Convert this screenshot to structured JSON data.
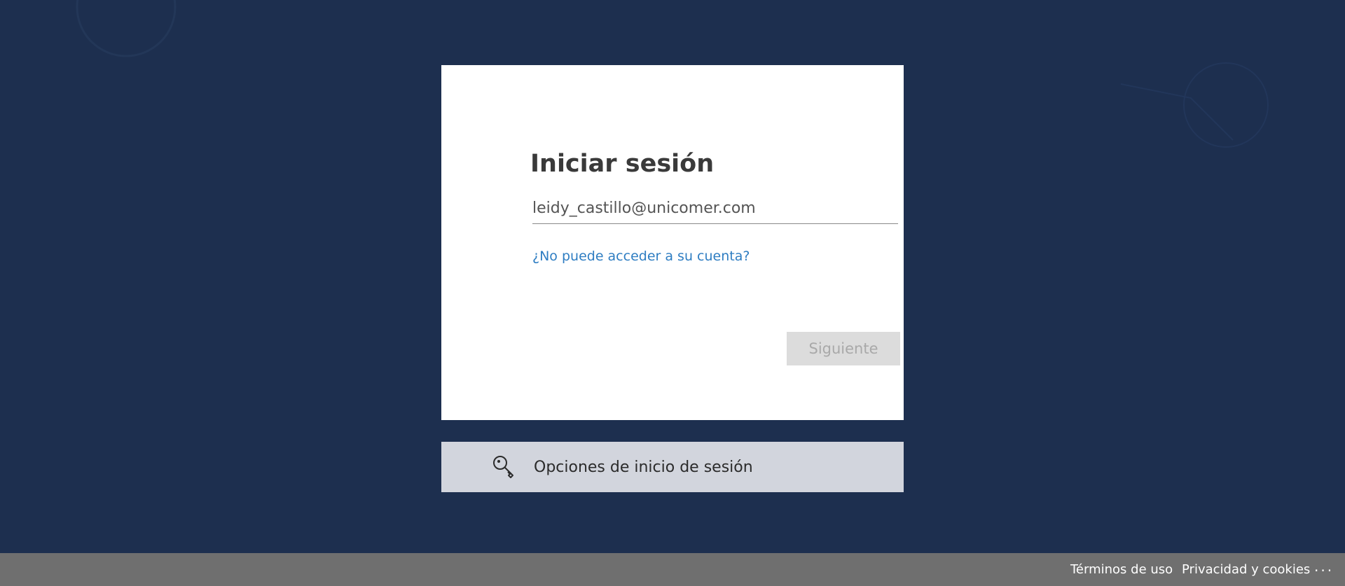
{
  "page": {
    "background_color": "#1d2f4f"
  },
  "signin_card": {
    "title": "Iniciar sesión",
    "email_value": "leidy_castillo@unicomer.com",
    "cant_access_link": "¿No puede acceder a su cuenta?",
    "next_button_label": "Siguiente"
  },
  "options_bar": {
    "icon": "key-search-icon",
    "label": "Opciones de inicio de sesión"
  },
  "footer": {
    "terms_label": "Términos de uso",
    "privacy_label": "Privacidad y cookies",
    "more_label": "..."
  },
  "colors": {
    "accent_link": "#2e7dc2",
    "button_disabled": "#dcdcdc",
    "footer_bg": "#6f6f6f",
    "options_bg": "#d2d5dd"
  }
}
